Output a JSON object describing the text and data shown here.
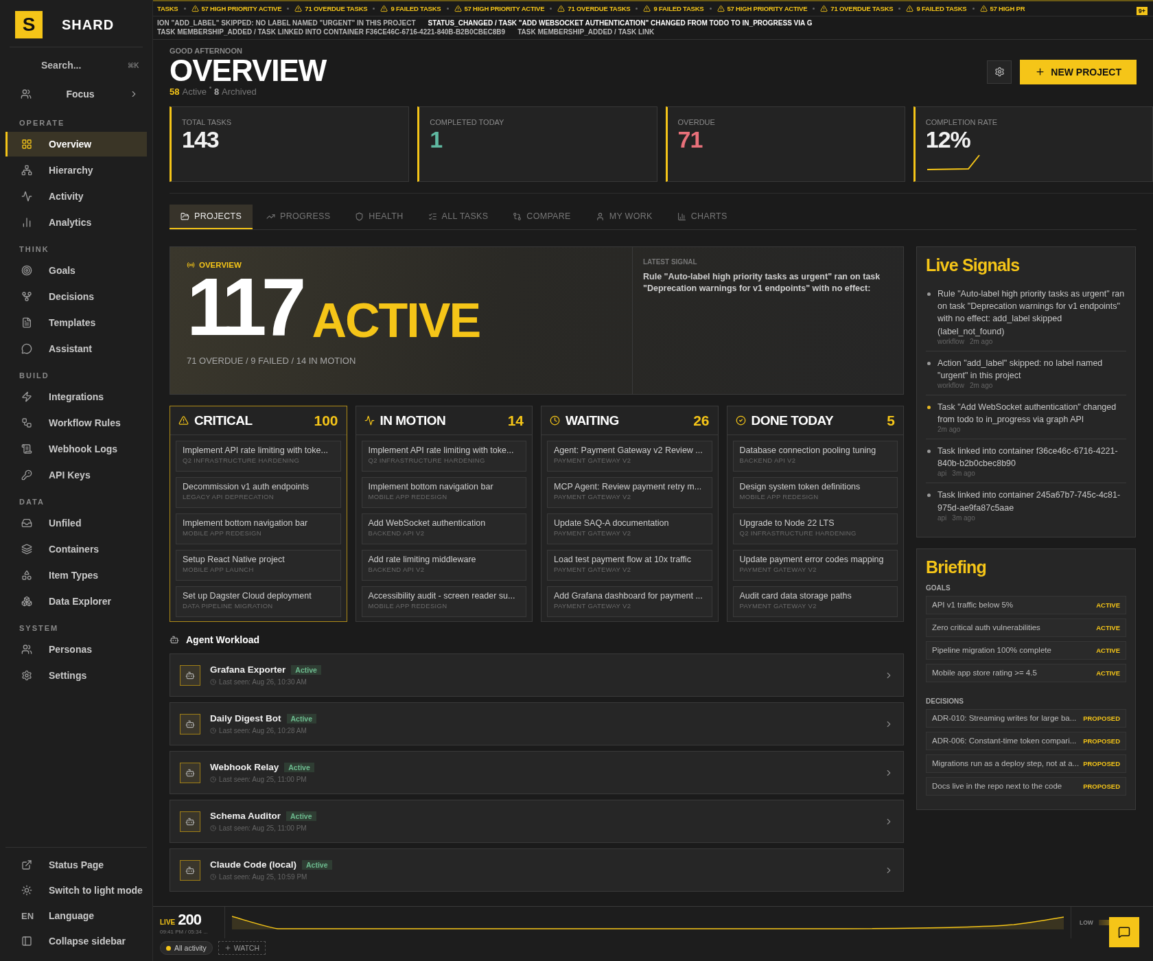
{
  "brand": {
    "logo": "S",
    "name": "SHARD"
  },
  "search": {
    "placeholder": "Search...",
    "shortcut": "⌘K"
  },
  "focus": {
    "label": "Focus"
  },
  "sidebar": {
    "sections": [
      {
        "title": "OPERATE",
        "items": [
          {
            "label": "Overview",
            "selected": true
          },
          {
            "label": "Hierarchy",
            "selected": false
          },
          {
            "label": "Activity",
            "selected": false
          },
          {
            "label": "Analytics",
            "selected": false
          }
        ]
      },
      {
        "title": "THINK",
        "items": [
          {
            "label": "Goals",
            "selected": false
          },
          {
            "label": "Decisions",
            "selected": false
          },
          {
            "label": "Templates",
            "selected": false
          },
          {
            "label": "Assistant",
            "selected": false
          }
        ]
      },
      {
        "title": "BUILD",
        "items": [
          {
            "label": "Integrations",
            "selected": false
          },
          {
            "label": "Workflow Rules",
            "selected": false
          },
          {
            "label": "Webhook Logs",
            "selected": false
          },
          {
            "label": "API Keys",
            "selected": false
          }
        ]
      },
      {
        "title": "DATA",
        "items": [
          {
            "label": "Unfiled",
            "selected": false
          },
          {
            "label": "Containers",
            "selected": false
          },
          {
            "label": "Item Types",
            "selected": false
          },
          {
            "label": "Data Explorer",
            "selected": false
          }
        ]
      },
      {
        "title": "SYSTEM",
        "items": [
          {
            "label": "Personas",
            "selected": false
          },
          {
            "label": "Settings",
            "selected": false
          }
        ]
      }
    ],
    "footer": [
      {
        "kind": "icon",
        "label": "Status Page"
      },
      {
        "kind": "icon",
        "label": "Switch to light mode"
      },
      {
        "kind": "code",
        "code": "EN",
        "label": "Language"
      },
      {
        "kind": "icon",
        "label": "Collapse sidebar"
      }
    ]
  },
  "ticker": {
    "alerts": [
      "TASKS",
      "57 HIGH PRIORITY ACTIVE",
      "71 OVERDUE TASKS",
      "9 FAILED TASKS",
      "57 HIGH PRIORITY ACTIVE",
      "71 OVERDUE TASKS",
      "9 FAILED TASKS",
      "57 HIGH PRIORITY ACTIVE",
      "71 OVERDUE TASKS",
      "9 FAILED TASKS",
      "57 HIGH PR"
    ],
    "events": [
      {
        "text": "ION \"ADD_LABEL\" SKIPPED: NO LABEL NAMED \"URGENT\" IN THIS PROJECT",
        "selected": false
      },
      {
        "text": "STATUS_CHANGED / TASK \"ADD WEBSOCKET AUTHENTICATION\" CHANGED FROM TODO TO IN_PROGRESS VIA G",
        "selected": true
      },
      {
        "text": "TASK MEMBERSHIP_ADDED / TASK LINKED INTO CONTAINER F36CE46C-6716-4221-840B-B2B0CBEC8B9",
        "selected": false
      },
      {
        "text": "TASK MEMBERSHIP_ADDED / TASK LINK",
        "selected": false
      }
    ],
    "badge": "9+"
  },
  "header": {
    "greeting": "GOOD AFTERNOON",
    "title": "OVERVIEW",
    "active_count": "58",
    "active_label": "Active",
    "archived_count": "8",
    "archived_label": "Archived",
    "new_button": "NEW PROJECT"
  },
  "stats": [
    {
      "label": "TOTAL TASKS",
      "value": "143",
      "color": "#f2f2f2"
    },
    {
      "label": "COMPLETED TODAY",
      "value": "1",
      "color": "#5fb8a0"
    },
    {
      "label": "OVERDUE",
      "value": "71",
      "color": "#e8707a"
    },
    {
      "label": "COMPLETION RATE",
      "value": "12%",
      "color": "#f2f2f2",
      "kind": "spark"
    }
  ],
  "tabs": [
    {
      "label": "PROJECTS",
      "selected": true
    },
    {
      "label": "PROGRESS",
      "selected": false
    },
    {
      "label": "HEALTH",
      "selected": false
    },
    {
      "label": "ALL TASKS",
      "selected": false
    },
    {
      "label": "COMPARE",
      "selected": false
    },
    {
      "label": "MY WORK",
      "selected": false
    },
    {
      "label": "CHARTS",
      "selected": false
    }
  ],
  "hero": {
    "label": "OVERVIEW",
    "number": "117",
    "word": "ACTIVE",
    "summary": "71 OVERDUE / 9 FAILED / 14 IN MOTION",
    "signal_label": "LATEST SIGNAL",
    "signal_text": "Rule \"Auto-label high priority tasks as urgent\" ran on task \"Deprecation warnings for v1 endpoints\" with no effect:"
  },
  "columns": [
    {
      "kind": "critical",
      "title": "CRITICAL",
      "count": "100",
      "highlighted": true,
      "tasks": [
        {
          "title": "Implement API rate limiting with toke...",
          "project": "Q2 INFRASTRUCTURE HARDENING"
        },
        {
          "title": "Decommission v1 auth endpoints",
          "project": "LEGACY API DEPRECATION"
        },
        {
          "title": "Implement bottom navigation bar",
          "project": "MOBILE APP REDESIGN"
        },
        {
          "title": "Setup React Native project",
          "project": "MOBILE APP LAUNCH"
        },
        {
          "title": "Set up Dagster Cloud deployment",
          "project": "DATA PIPELINE MIGRATION"
        }
      ]
    },
    {
      "kind": "motion",
      "title": "IN MOTION",
      "count": "14",
      "highlighted": false,
      "tasks": [
        {
          "title": "Implement API rate limiting with toke...",
          "project": "Q2 INFRASTRUCTURE HARDENING"
        },
        {
          "title": "Implement bottom navigation bar",
          "project": "MOBILE APP REDESIGN"
        },
        {
          "title": "Add WebSocket authentication",
          "project": "BACKEND API V2"
        },
        {
          "title": "Add rate limiting middleware",
          "project": "BACKEND API V2"
        },
        {
          "title": "Accessibility audit - screen reader su...",
          "project": "MOBILE APP REDESIGN"
        }
      ]
    },
    {
      "kind": "waiting",
      "title": "WAITING",
      "count": "26",
      "highlighted": false,
      "tasks": [
        {
          "title": "Agent: Payment Gateway v2 Review ...",
          "project": "PAYMENT GATEWAY V2"
        },
        {
          "title": "MCP Agent: Review payment retry m...",
          "project": "PAYMENT GATEWAY V2"
        },
        {
          "title": "Update SAQ-A documentation",
          "project": "PAYMENT GATEWAY V2"
        },
        {
          "title": "Load test payment flow at 10x traffic",
          "project": "PAYMENT GATEWAY V2"
        },
        {
          "title": "Add Grafana dashboard for payment ...",
          "project": "PAYMENT GATEWAY V2"
        }
      ]
    },
    {
      "kind": "done",
      "title": "DONE TODAY",
      "count": "5",
      "highlighted": false,
      "tasks": [
        {
          "title": "Database connection pooling tuning",
          "project": "BACKEND API V2"
        },
        {
          "title": "Design system token definitions",
          "project": "MOBILE APP REDESIGN"
        },
        {
          "title": "Upgrade to Node 22 LTS",
          "project": "Q2 INFRASTRUCTURE HARDENING"
        },
        {
          "title": "Update payment error codes mapping",
          "project": "PAYMENT GATEWAY V2"
        },
        {
          "title": "Audit card data storage paths",
          "project": "PAYMENT GATEWAY V2"
        }
      ]
    }
  ],
  "agents": {
    "title": "Agent Workload",
    "items": [
      {
        "name": "Grafana Exporter",
        "status": "Active",
        "last_seen": "Last seen: Aug 26, 10:30 AM"
      },
      {
        "name": "Daily Digest Bot",
        "status": "Active",
        "last_seen": "Last seen: Aug 26, 10:28 AM"
      },
      {
        "name": "Webhook Relay",
        "status": "Active",
        "last_seen": "Last seen: Aug 25, 11:00 PM"
      },
      {
        "name": "Schema Auditor",
        "status": "Active",
        "last_seen": "Last seen: Aug 25, 11:00 PM"
      },
      {
        "name": "Claude Code (local)",
        "status": "Active",
        "last_seen": "Last seen: Aug 25, 10:59 PM"
      }
    ]
  },
  "live_signals": {
    "title": "Live Signals",
    "items": [
      {
        "text": "Rule \"Auto-label high priority tasks as urgent\" ran on task \"Deprecation warnings for v1 endpoints\" with no effect: add_label skipped (label_not_found)",
        "source": "workflow",
        "time": "2m ago",
        "color": "#9a9a9a"
      },
      {
        "text": "Action \"add_label\" skipped: no label named \"urgent\" in this project",
        "source": "workflow",
        "time": "2m ago",
        "color": "#9a9a9a"
      },
      {
        "text": "Task \"Add WebSocket authentication\" changed from todo to in_progress via graph API",
        "time": "2m ago",
        "color": "#e8b923"
      },
      {
        "text": "Task linked into container f36ce46c-6716-4221-840b-b2b0cbec8b90",
        "source": "api",
        "time": "3m ago",
        "color": "#9a9a9a"
      },
      {
        "text": "Task linked into container 245a67b7-745c-4c81-975d-ae9fa87c5aae",
        "source": "api",
        "time": "3m ago",
        "color": "#9a9a9a"
      }
    ]
  },
  "briefing": {
    "title": "Briefing",
    "goals_label": "GOALS",
    "goals": [
      {
        "text": "API v1 traffic below 5%",
        "status": "ACTIVE"
      },
      {
        "text": "Zero critical auth vulnerabilities",
        "status": "ACTIVE"
      },
      {
        "text": "Pipeline migration 100% complete",
        "status": "ACTIVE"
      },
      {
        "text": "Mobile app store rating >= 4.5",
        "status": "ACTIVE"
      }
    ],
    "decisions_label": "DECISIONS",
    "decisions": [
      {
        "text": "ADR-010: Streaming writes for large ba...",
        "status": "PROPOSED"
      },
      {
        "text": "ADR-006: Constant-time token compari...",
        "status": "PROPOSED"
      },
      {
        "text": "Migrations run as a deploy step, not at a...",
        "status": "PROPOSED"
      },
      {
        "text": "Docs live in the repo next to the code",
        "status": "PROPOSED"
      }
    ]
  },
  "live_bar": {
    "label": "LIVE",
    "count": "200",
    "time": "09:41 PM / 05:34 ...",
    "low_label": "LOW",
    "filter": "All activity",
    "watch": "WATCH"
  }
}
